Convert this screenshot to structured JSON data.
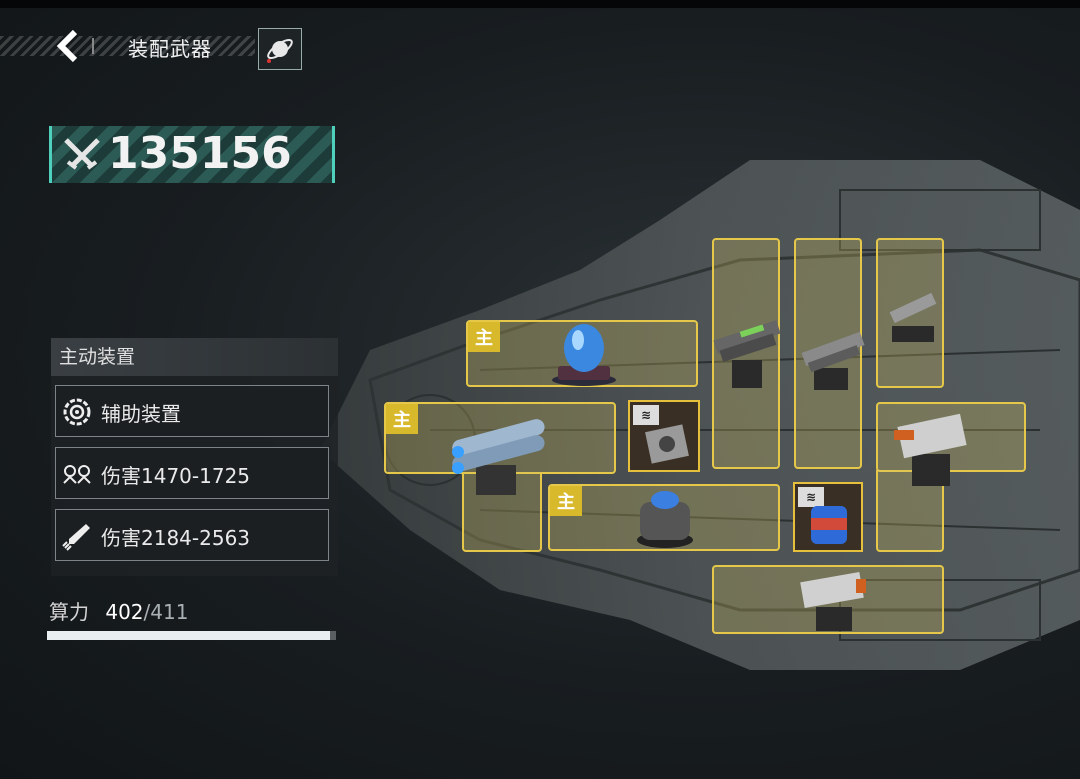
{
  "header": {
    "title": "装配武器"
  },
  "power": {
    "value": "135156"
  },
  "active_panel": {
    "title": "主动装置",
    "rows": [
      {
        "label": "辅助装置",
        "icon": "crosshair-gear-icon"
      },
      {
        "label": "伤害1470-1725",
        "icon": "drones-icon"
      },
      {
        "label": "伤害2184-2563",
        "icon": "missile-icon"
      }
    ]
  },
  "compute": {
    "label": "算力",
    "current": "402",
    "separator": "/",
    "max": "411",
    "fraction": 0.978
  },
  "slots": {
    "main_badge": "主",
    "mod_tag": "≋"
  },
  "colors": {
    "slot_border": "#e5c84a",
    "accent_teal": "#4fd0bd",
    "badge": "#d9b92c"
  }
}
